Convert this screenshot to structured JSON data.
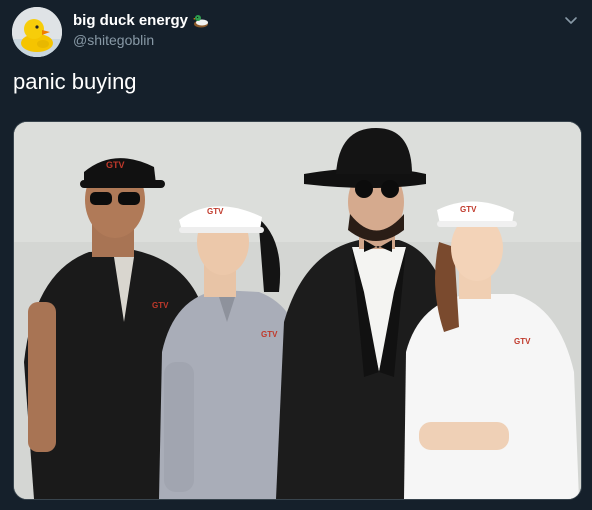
{
  "user": {
    "display_name": "big duck energy",
    "handle": "@shitegoblin"
  },
  "tweet": {
    "text": "panic buying"
  },
  "media": {
    "logo_text": "GTV"
  },
  "icons": {
    "avatar": "rubber-duck-avatar",
    "name_badge": "duck-emoji-icon",
    "menu": "chevron-down-icon"
  },
  "colors": {
    "background": "#15202b",
    "secondary_text": "#8899a6",
    "primary_text": "#ffffff"
  }
}
